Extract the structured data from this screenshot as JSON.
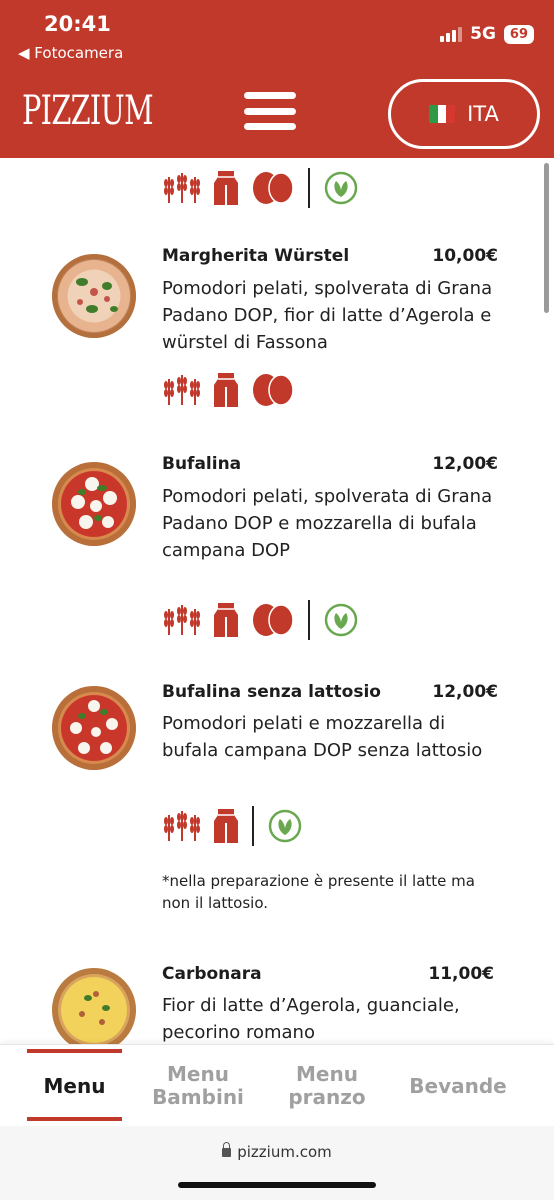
{
  "status": {
    "time": "20:41",
    "back_label": "◀ Fotocamera",
    "network": "5G",
    "battery": "69"
  },
  "header": {
    "logo_text": "PIZZIUM",
    "lang_label": "ITA"
  },
  "colors": {
    "brand_red": "#c1392b",
    "icon_red": "#c1392b",
    "vegetarian_green": "#6aa84f"
  },
  "menu": {
    "items": [
      {
        "name": "Margherita Würstel",
        "price": "10,00€",
        "description": "Pomodori pelati, spolverata di Grana Padano DOP, fior di latte d’Agerola e würstel di Fassona",
        "icons": [
          "wheat-icon",
          "milk-carton-icon",
          "eggs-icon"
        ]
      },
      {
        "name": "Bufalina",
        "price": "12,00€",
        "description": "Pomodori pelati, spolverata di Grana Padano DOP e mozzarella di bufala campana DOP",
        "icons": [
          "wheat-icon",
          "milk-carton-icon",
          "eggs-icon",
          "vegetarian-leaf-icon"
        ]
      },
      {
        "name": "Bufalina senza lattosio",
        "price": "12,00€",
        "description": "Pomodori pelati e mozzarella di bufala campana DOP senza lattosio",
        "icons": [
          "wheat-icon",
          "milk-carton-icon",
          "vegetarian-leaf-icon"
        ],
        "note": "*nella preparazione è presente il latte ma non il lattosio."
      },
      {
        "name": "Carbonara",
        "price": "11,00€",
        "description": "Fior di latte d’Agerola, guanciale, pecorino romano"
      }
    ]
  },
  "tabs": [
    {
      "label": "Menu",
      "active": true
    },
    {
      "label": "Menu Bambini",
      "active": false
    },
    {
      "label": "Menu pranzo",
      "active": false
    },
    {
      "label": "Bevande",
      "active": false
    }
  ],
  "browser": {
    "url": "pizzium.com"
  }
}
